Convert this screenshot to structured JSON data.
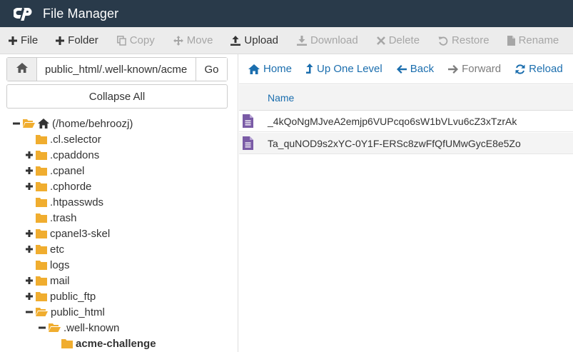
{
  "app": {
    "title": "File Manager"
  },
  "toolbar": {
    "file": "File",
    "folder": "Folder",
    "copy": "Copy",
    "move": "Move",
    "upload": "Upload",
    "download": "Download",
    "delete": "Delete",
    "restore": "Restore",
    "rename": "Rename"
  },
  "path": {
    "value": "public_html/.well-known/acme",
    "go": "Go"
  },
  "collapse_all": "Collapse All",
  "tree": {
    "root": "(/home/behroozj)",
    "items": [
      {
        "label": ".cl.selector"
      },
      {
        "label": ".cpaddons"
      },
      {
        "label": ".cpanel"
      },
      {
        "label": ".cphorde"
      },
      {
        "label": ".htpasswds"
      },
      {
        "label": ".trash"
      },
      {
        "label": "cpanel3-skel"
      },
      {
        "label": "etc"
      },
      {
        "label": "logs"
      },
      {
        "label": "mail"
      },
      {
        "label": "public_ftp"
      },
      {
        "label": "public_html"
      },
      {
        "label": ".well-known"
      },
      {
        "label": "acme-challenge"
      }
    ]
  },
  "nav": {
    "home": "Home",
    "up": "Up One Level",
    "back": "Back",
    "forward": "Forward",
    "reload": "Reload"
  },
  "list": {
    "name_header": "Name",
    "files": [
      {
        "name": "_4kQoNgMJveA2emjp6VUPcqo6sW1bVLvu6cZ3xTzrAk"
      },
      {
        "name": "Ta_quNOD9s2xYC-0Y1F-ERSc8zwFfQfUMwGycE8e5Zo"
      }
    ]
  },
  "colors": {
    "titlebar": "#293a4a",
    "toolbar": "#ececec",
    "link": "#1b6eae",
    "folder": "#f0ad2f",
    "file_icon": "#7a5ba6"
  }
}
